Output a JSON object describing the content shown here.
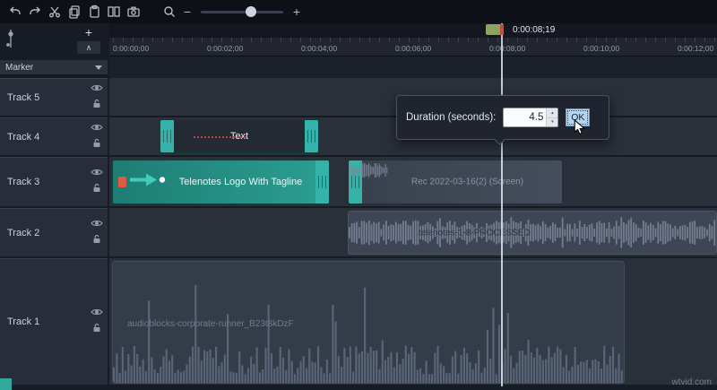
{
  "icons": {
    "add": "+",
    "collapse": "∧",
    "minus": "−",
    "plus": "+",
    "spinner_up": "▴",
    "spinner_down": "▾"
  },
  "playhead": {
    "time": "0:00:08;19"
  },
  "ruler": {
    "ticks": [
      "0:00:00;00",
      "0:00:02;00",
      "0:00:04;00",
      "0:00:06;00",
      "0:00:08;00",
      "0:00:10;00",
      "0:00:12;00"
    ]
  },
  "panel": {
    "marker_label": "Marker",
    "tracks": [
      {
        "name": "Track 5"
      },
      {
        "name": "Track 4"
      },
      {
        "name": "Track 3"
      },
      {
        "name": "Track 2"
      },
      {
        "name": "Track 1"
      }
    ]
  },
  "clips": {
    "text": {
      "label": "Text"
    },
    "logo": {
      "label": "Telenotes Logo With Tagline"
    },
    "screen": {
      "label": "Rec 2022-03-16(2) (Screen)"
    },
    "audio2": {
      "label": "telenotes-1-8-PROCESSED"
    },
    "audio1": {
      "label": "audioblocks-corporate-runner_B23t8kDzF"
    }
  },
  "dialog": {
    "label": "Duration (seconds):",
    "value": "4.5",
    "ok_label": "OK"
  },
  "watermark": "wtvid.com",
  "colors": {
    "accent": "#2fa99b",
    "playhead_red": "#c74b41",
    "selection": "#35b3a8"
  }
}
